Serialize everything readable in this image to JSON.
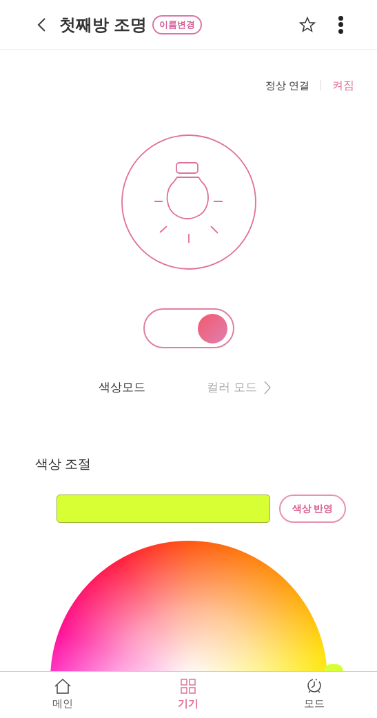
{
  "header": {
    "title": "첫째방 조명",
    "rename_button": "이름변경",
    "favorite": false
  },
  "status": {
    "connection": "정상 연결",
    "power": "켜짐"
  },
  "power_toggle": {
    "on": true
  },
  "color_mode": {
    "label": "색상모드",
    "value": "컬러 모드"
  },
  "color_control": {
    "title": "색상 조절",
    "color": "#d8ff33",
    "apply_button": "색상 반영"
  },
  "nav": [
    {
      "label": "메인",
      "kind": "home",
      "selected": false
    },
    {
      "label": "기기",
      "kind": "devices",
      "selected": true
    },
    {
      "label": "모드",
      "kind": "clock",
      "selected": false
    }
  ]
}
